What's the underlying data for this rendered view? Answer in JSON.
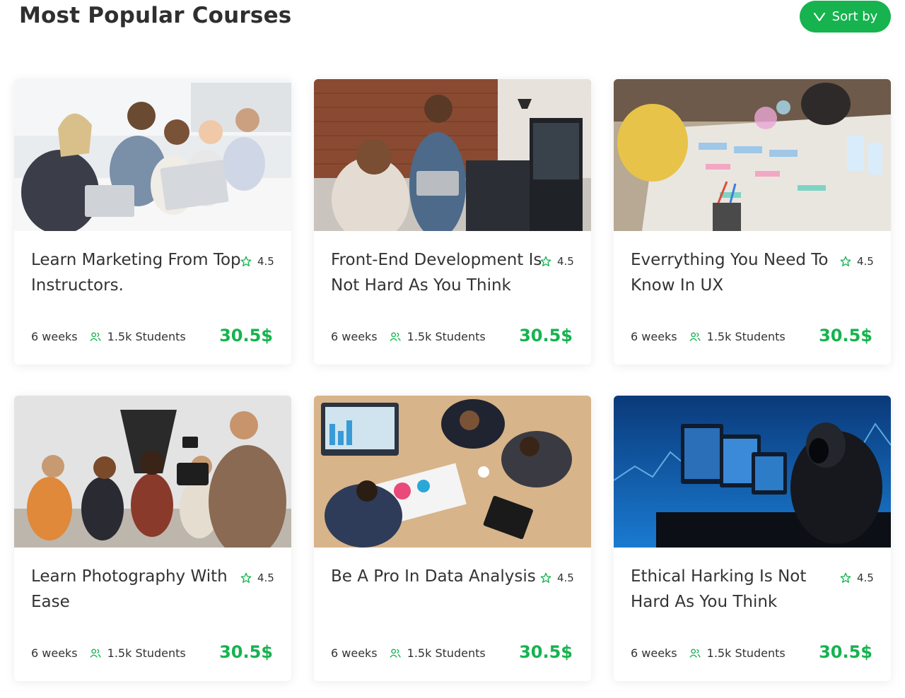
{
  "header": {
    "title": "Most Popular Courses",
    "sort_label": "Sort by"
  },
  "colors": {
    "accent": "#16b34f",
    "text": "#333333"
  },
  "courses": [
    {
      "title": "Learn Marketing From Top Instructors.",
      "rating": "4.5",
      "duration": "6 weeks",
      "students": "1.5k Students",
      "price": "30.5$"
    },
    {
      "title": "Front-End Development Is Not Hard As You Think",
      "rating": "4.5",
      "duration": "6 weeks",
      "students": "1.5k Students",
      "price": "30.5$"
    },
    {
      "title": "Everrything You Need To Know In UX",
      "rating": "4.5",
      "duration": "6 weeks",
      "students": "1.5k Students",
      "price": "30.5$"
    },
    {
      "title": "Learn Photography With Ease",
      "rating": "4.5",
      "duration": "6 weeks",
      "students": "1.5k Students",
      "price": "30.5$"
    },
    {
      "title": "Be A Pro In Data Analysis",
      "rating": "4.5",
      "duration": "6 weeks",
      "students": "1.5k Students",
      "price": "30.5$"
    },
    {
      "title": "Ethical Harking Is Not Hard As You Think",
      "rating": "4.5",
      "duration": "6 weeks",
      "students": "1.5k Students",
      "price": "30.5$"
    }
  ]
}
